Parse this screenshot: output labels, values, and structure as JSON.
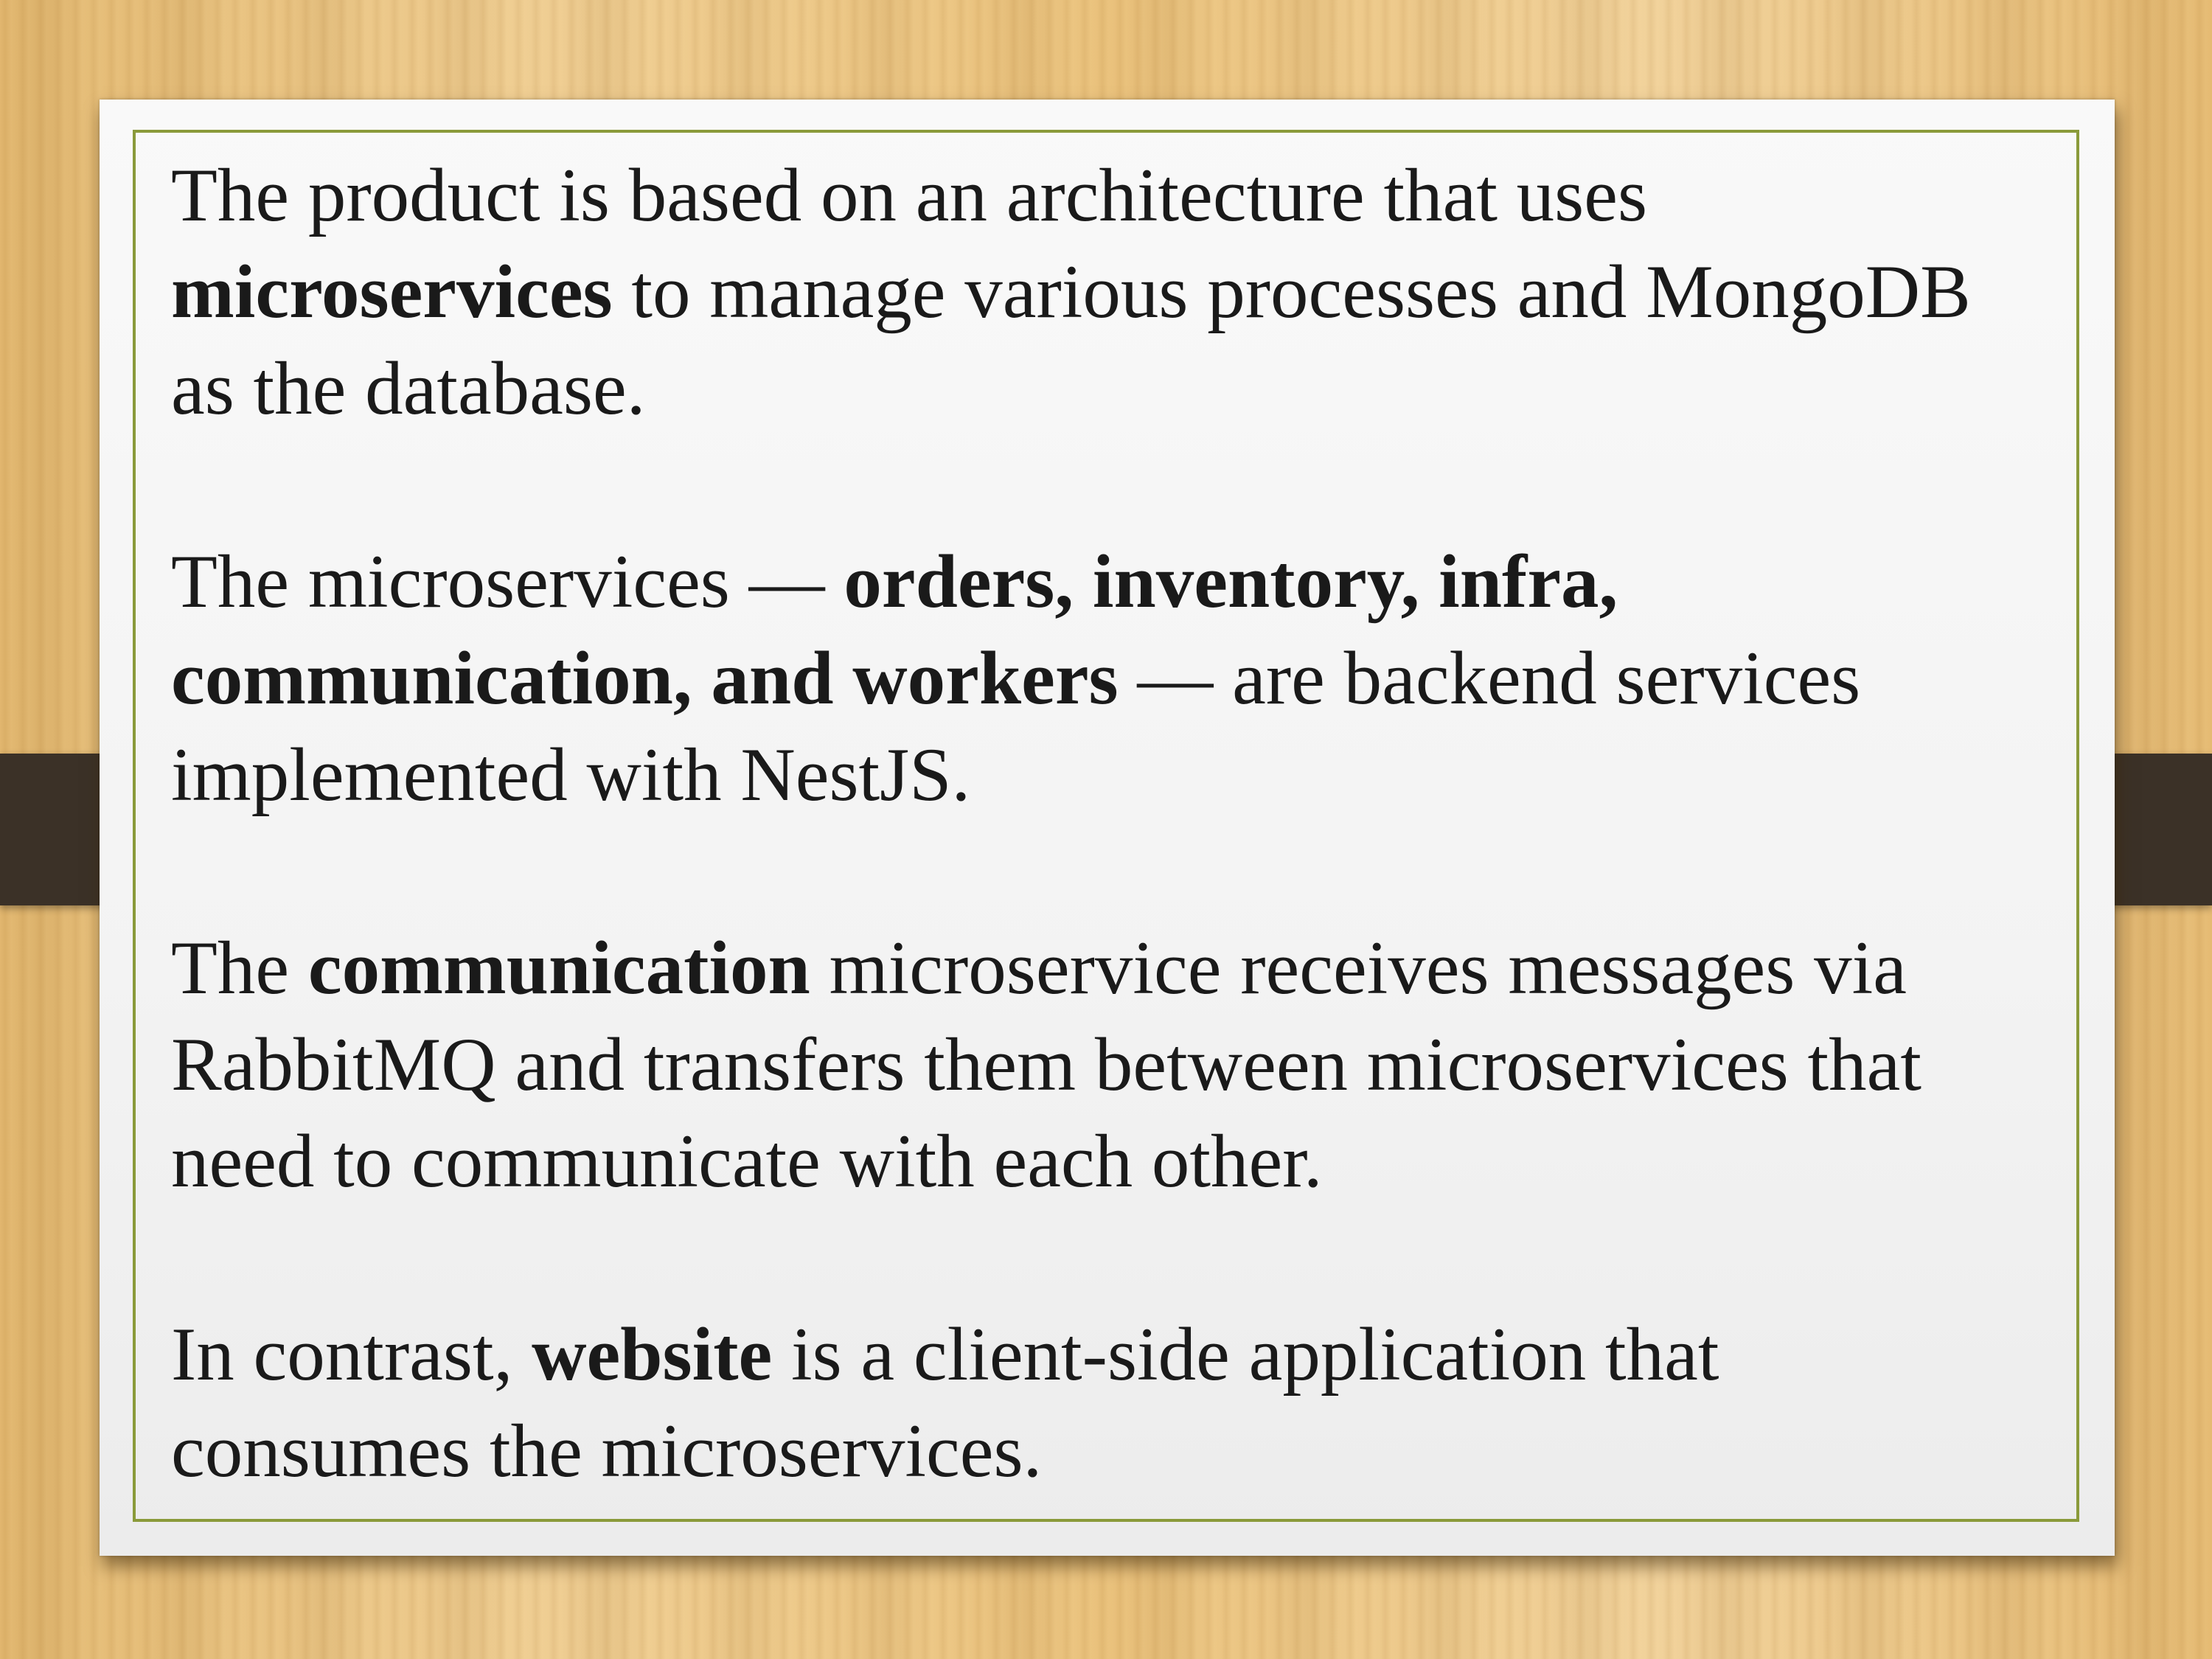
{
  "slide": {
    "paragraphs": [
      {
        "runs": [
          {
            "text": "The product is based on an architecture that uses",
            "bold": false
          },
          {
            "br": true
          },
          {
            "text": "microservices",
            "bold": true
          },
          {
            "text": " to manage various processes and MongoDB",
            "bold": false
          },
          {
            "br": true
          },
          {
            "text": "as the database.",
            "bold": false
          }
        ]
      },
      {
        "runs": [
          {
            "text": "The microservices — ",
            "bold": false
          },
          {
            "text": "orders, inventory, infra,",
            "bold": true
          },
          {
            "br": true
          },
          {
            "text": "communication, and workers",
            "bold": true
          },
          {
            "text": " — are backend services",
            "bold": false
          },
          {
            "br": true
          },
          {
            "text": "implemented with NestJS.",
            "bold": false
          }
        ]
      },
      {
        "runs": [
          {
            "text": "The ",
            "bold": false
          },
          {
            "text": "communication",
            "bold": true
          },
          {
            "text": " microservice receives messages via",
            "bold": false
          },
          {
            "br": true
          },
          {
            "text": "RabbitMQ and transfers them between microservices that",
            "bold": false
          },
          {
            "br": true
          },
          {
            "text": "need to communicate with each other.",
            "bold": false
          }
        ]
      },
      {
        "runs": [
          {
            "text": "In contrast, ",
            "bold": false
          },
          {
            "text": "website",
            "bold": true
          },
          {
            "text": " is a client-side application that",
            "bold": false
          },
          {
            "br": true
          },
          {
            "text": "consumes the microservices.",
            "bold": false
          }
        ]
      }
    ]
  },
  "colors": {
    "frame_border": "#8a9a3a",
    "text": "#1a1a1a",
    "strap": "#3b3127",
    "wood": "#e9c07a"
  }
}
